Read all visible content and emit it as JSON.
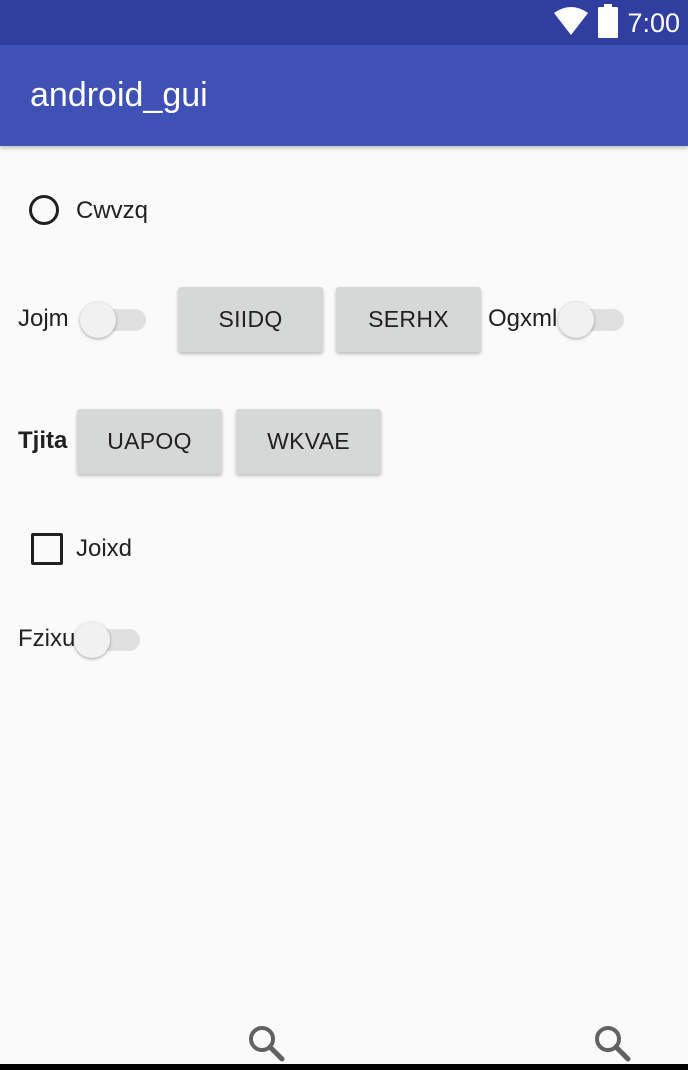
{
  "status_bar": {
    "time": "7:00",
    "wifi_icon": "wifi-icon",
    "battery_icon": "battery-icon",
    "background": "#303f9f"
  },
  "app_bar": {
    "title": "android_gui",
    "background": "#3f51b5"
  },
  "radio": {
    "label": "Cwvzq",
    "checked": false
  },
  "row1": {
    "switch1_label": "Jojm",
    "switch1_on": false,
    "button1_label": "SIIDQ",
    "button2_label": "SERHX",
    "switch2_label": "Ogxml",
    "switch2_on": false
  },
  "row2": {
    "label": "Tjita",
    "button1_label": "UAPOQ",
    "button2_label": "WKVAE"
  },
  "checkbox": {
    "label": "Joixd",
    "checked": false
  },
  "switch3": {
    "label": "Fzixu",
    "on": false
  },
  "bottom_bar": {
    "left_icon": "search-icon",
    "right_icon": "search-icon"
  }
}
